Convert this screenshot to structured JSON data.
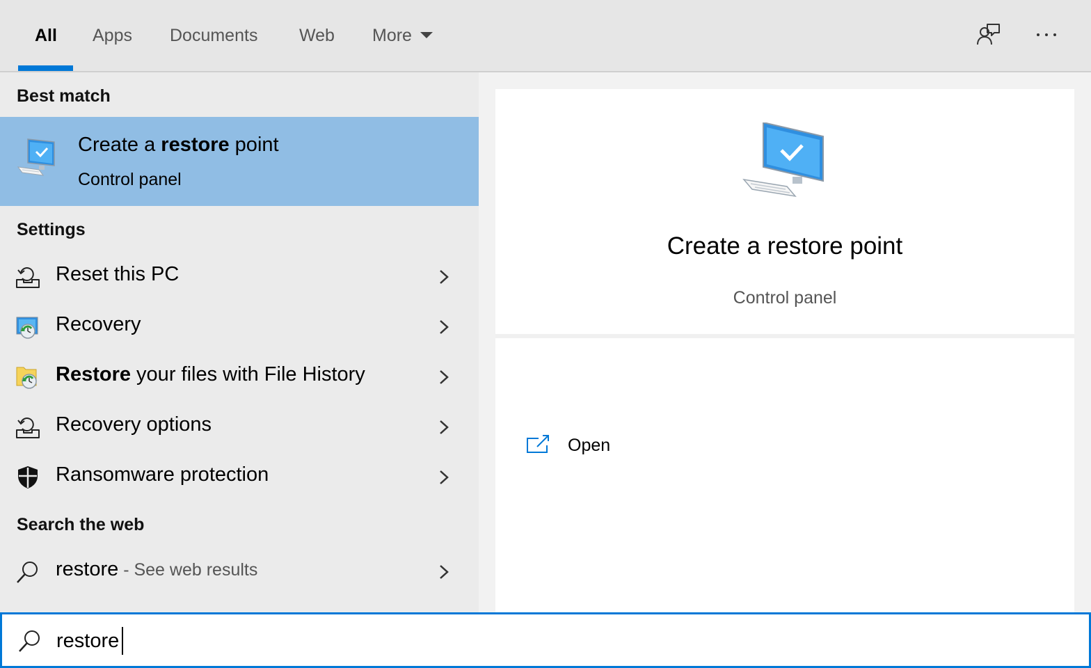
{
  "tabs": [
    {
      "label": "All"
    },
    {
      "label": "Apps"
    },
    {
      "label": "Documents"
    },
    {
      "label": "Web"
    },
    {
      "label": "More"
    }
  ],
  "top_icons": {
    "feedback": "feedback-icon",
    "more": "ellipsis-icon"
  },
  "best_match": {
    "section_title": "Best match",
    "title_pre": "Create a ",
    "title_bold": "restore",
    "title_post": " point",
    "subtitle": "Control panel",
    "icon": "computer-check-icon"
  },
  "settings": {
    "section_title": "Settings",
    "items": [
      {
        "pre": "",
        "bold": "",
        "post": "Reset this PC",
        "icon": "reset-pc-icon"
      },
      {
        "pre": "",
        "bold": "",
        "post": "Recovery",
        "icon": "recovery-icon"
      },
      {
        "pre": "",
        "bold": "Restore",
        "post": " your files with File History",
        "icon": "file-history-icon"
      },
      {
        "pre": "",
        "bold": "",
        "post": "Recovery options",
        "icon": "recovery-options-icon"
      },
      {
        "pre": "",
        "bold": "",
        "post": "Ransomware protection",
        "icon": "shield-icon"
      }
    ]
  },
  "web": {
    "section_title": "Search the web",
    "query": "restore",
    "suffix": " - See web results",
    "icon": "search-icon"
  },
  "detail": {
    "title": "Create a restore point",
    "subtitle": "Control panel",
    "actions": [
      {
        "label": "Open",
        "icon": "open-external-icon"
      }
    ]
  },
  "search": {
    "value": "restore",
    "placeholder": ""
  },
  "colors": {
    "accent": "#0078d7",
    "selection": "#90bde4"
  }
}
